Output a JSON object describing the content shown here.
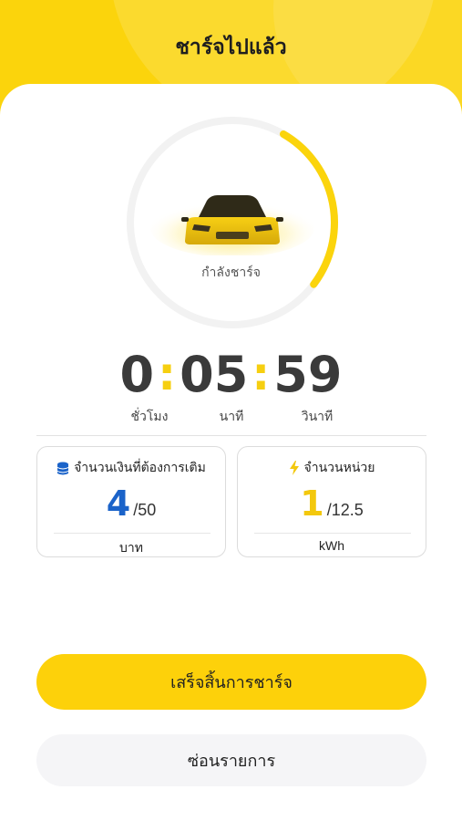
{
  "header": {
    "title": "ชาร์จไปแล้ว"
  },
  "charging": {
    "status_text": "กำลังชาร์จ",
    "progress_fraction": 0.27,
    "accent_color": "#fbd40c",
    "icon": "car-icon"
  },
  "timer": {
    "hours": "0",
    "minutes": "05",
    "seconds": "59",
    "separator": ":",
    "hours_label": "ชั่วโมง",
    "minutes_label": "นาที",
    "seconds_label": "วินาที"
  },
  "money_box": {
    "icon": "coins-icon",
    "title": "จำนวนเงินที่ต้องการเติม",
    "current": "4",
    "total": "/50",
    "unit": "บาท",
    "value_color": "#1b63c9"
  },
  "energy_box": {
    "icon": "lightning-icon",
    "title": "จำนวนหน่วย",
    "current": "1",
    "total": "/12.5",
    "unit": "kWh",
    "value_color": "#f3c80d"
  },
  "actions": {
    "finish_label": "เสร็จสิ้นการชาร์จ",
    "hide_label": "ซ่อนรายการ"
  }
}
